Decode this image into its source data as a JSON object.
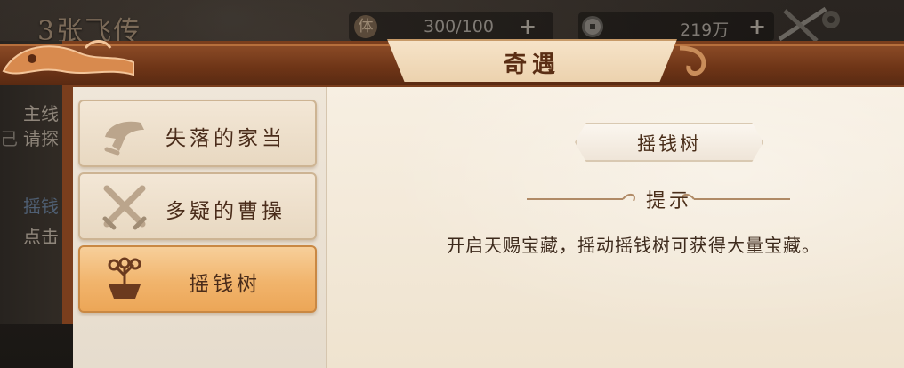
{
  "header": {
    "chapter_title": "3张飞传",
    "stamina": {
      "icon": "stamina-icon",
      "icon_char": "体",
      "value": "300/100"
    },
    "coins": {
      "icon": "coin-icon",
      "value": "219万"
    },
    "plus_symbol": "+"
  },
  "window": {
    "title": "奇遇"
  },
  "background_task": {
    "lines": [
      "主线",
      "请探",
      "摇钱",
      "点击"
    ],
    "edge_char": "己"
  },
  "adventures": [
    {
      "label": "失落的家当",
      "icon": "hand-coin-icon",
      "selected": false
    },
    {
      "label": "多疑的曹操",
      "icon": "crossed-swords-icon",
      "selected": false
    },
    {
      "label": "摇钱树",
      "icon": "money-tree-icon",
      "selected": true
    }
  ],
  "detail": {
    "name": "摇钱树",
    "hint_title": "提示",
    "hint_text": "开启天赐宝藏，摇动摇钱树可获得大量宝藏。"
  },
  "colors": {
    "frame": "#7a3e1d",
    "panel": "#efe3cf",
    "selected": "#f1b46c",
    "text": "#4a2e1a"
  }
}
